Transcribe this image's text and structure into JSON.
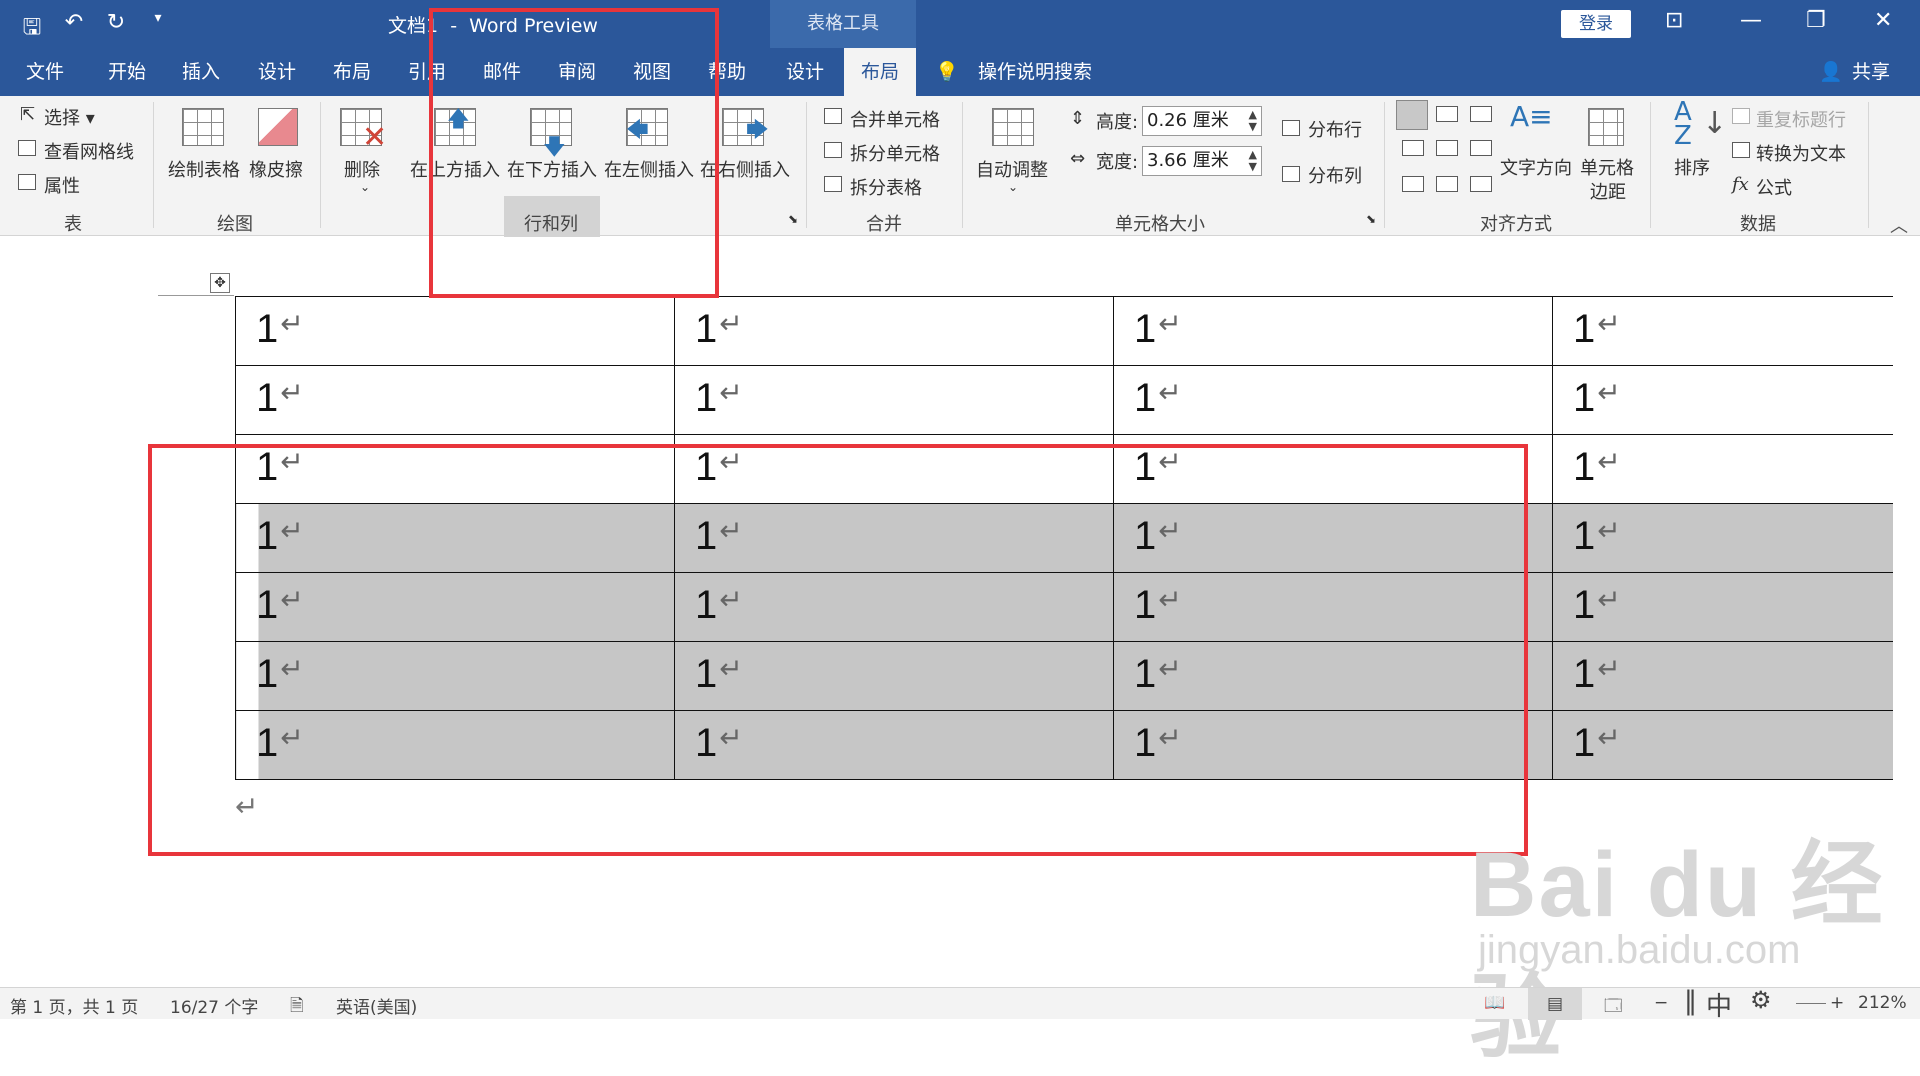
{
  "title": {
    "doc_name": "文档1",
    "app_name": "Word Preview",
    "separator": "-",
    "context_group": "表格工具",
    "login": "登录"
  },
  "tabs": [
    "文件",
    "开始",
    "插入",
    "设计",
    "布局",
    "引用",
    "邮件",
    "审阅",
    "视图",
    "帮助",
    "设计",
    "布局"
  ],
  "active_tab_index": 11,
  "tell_me": "操作说明搜索",
  "share": "共享",
  "ribbon": {
    "table_group": {
      "label": "表",
      "select": "选择",
      "view_gridlines": "查看网格线",
      "properties": "属性"
    },
    "draw_group": {
      "label": "绘图",
      "draw_table": "绘制表格",
      "eraser": "橡皮擦"
    },
    "rows_cols": {
      "label": "行和列",
      "delete": "删除",
      "insert_above": "在上方插入",
      "insert_below": "在下方插入",
      "insert_left": "在左侧插入",
      "insert_right": "在右侧插入"
    },
    "merge": {
      "label": "合并",
      "merge_cells": "合并单元格",
      "split_cells": "拆分单元格",
      "split_table": "拆分表格"
    },
    "cell_size": {
      "label": "单元格大小",
      "autofit": "自动调整",
      "height_label": "高度:",
      "height_value": "0.26 厘米",
      "width_label": "宽度:",
      "width_value": "3.66 厘米",
      "distribute_rows": "分布行",
      "distribute_cols": "分布列"
    },
    "alignment": {
      "label": "对齐方式",
      "text_direction": "文字方向",
      "cell_margins_1": "单元格",
      "cell_margins_2": "边距"
    },
    "data": {
      "label": "数据",
      "sort": "排序",
      "repeat_header": "重复标题行",
      "convert_text": "转换为文本",
      "formula": "公式",
      "fx": "fx"
    }
  },
  "table": {
    "rows": [
      [
        "1",
        "1",
        "1",
        "1"
      ],
      [
        "1",
        "1",
        "1",
        "1"
      ],
      [
        "1",
        "1",
        "1",
        "1"
      ],
      [
        "1",
        "1",
        "1",
        "1"
      ],
      [
        "1",
        "1",
        "1",
        "1"
      ],
      [
        "1",
        "1",
        "1",
        "1"
      ],
      [
        "1",
        "1",
        "1",
        "1"
      ]
    ],
    "selected_rows": [
      3,
      4,
      5,
      6
    ],
    "return_mark": "↵"
  },
  "watermark": {
    "logo": "Bai du 经验",
    "url": "jingyan.baidu.com"
  },
  "status": {
    "page": "第 1 页，共 1 页",
    "words": "16/27 个字",
    "language": "英语(美国)",
    "ime": "中",
    "zoom": "212%",
    "minus": "−",
    "plus": "+"
  }
}
